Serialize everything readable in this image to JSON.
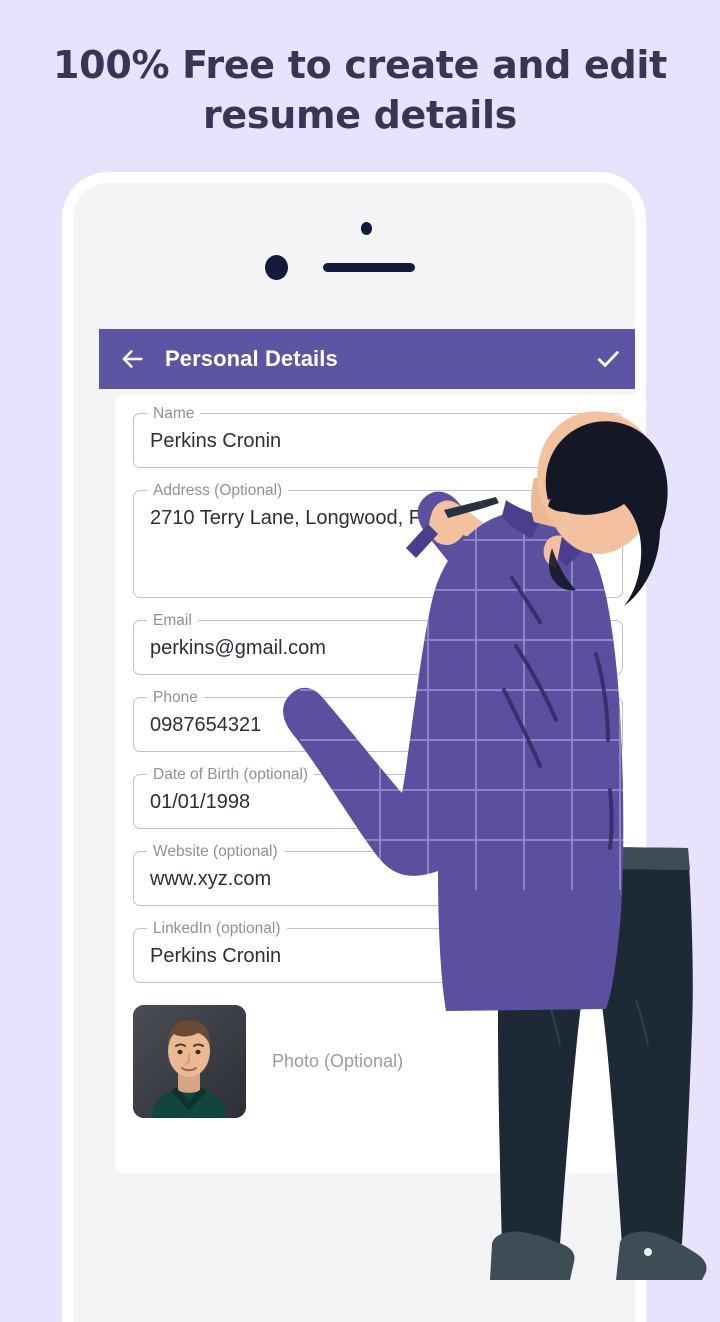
{
  "headline": {
    "line1": "100% Free to create and edit",
    "line2": "resume details"
  },
  "colors": {
    "page_background": "#E7E3FC",
    "appbar": "#5E54A4",
    "headline_text": "#3A3556",
    "card": "#FFFFFF",
    "field_border": "#BFC3C9",
    "label_text": "#8E9197",
    "value_text": "#2B2F3A",
    "shirt": "#5B4FA0",
    "trousers": "#1D2A35",
    "skin": "#F3C1A0",
    "hair": "#141726"
  },
  "appbar": {
    "back_icon": "arrow-left-icon",
    "title": "Personal Details",
    "confirm_icon": "check-icon"
  },
  "phone": {
    "sensor_icon": "proximity-sensor-dot",
    "camera_icon": "front-camera-dot",
    "speaker_icon": "earpiece-speaker"
  },
  "form": {
    "fields": [
      {
        "label": "Name",
        "value": "Perkins Cronin",
        "multiline": false
      },
      {
        "label": "Address (Optional)",
        "value": "2710  Terry Lane, Longwood, Flori",
        "multiline": true
      },
      {
        "label": "Email",
        "value": "perkins@gmail.com",
        "multiline": false
      },
      {
        "label": "Phone",
        "value": "0987654321",
        "multiline": false
      },
      {
        "label": "Date of Birth (optional)",
        "value": "01/01/1998",
        "multiline": false
      },
      {
        "label": "Website (optional)",
        "value": "www.xyz.com",
        "multiline": false
      },
      {
        "label": "LinkedIn (optional)",
        "value": "Perkins Cronin",
        "multiline": false
      }
    ],
    "photo": {
      "label": "Photo (Optional)",
      "alt": "portrait-of-man-in-green-shirt"
    }
  },
  "illustration": {
    "description": "man-seen-from-behind-writing-with-pen",
    "pen_icon": "pen-icon"
  }
}
